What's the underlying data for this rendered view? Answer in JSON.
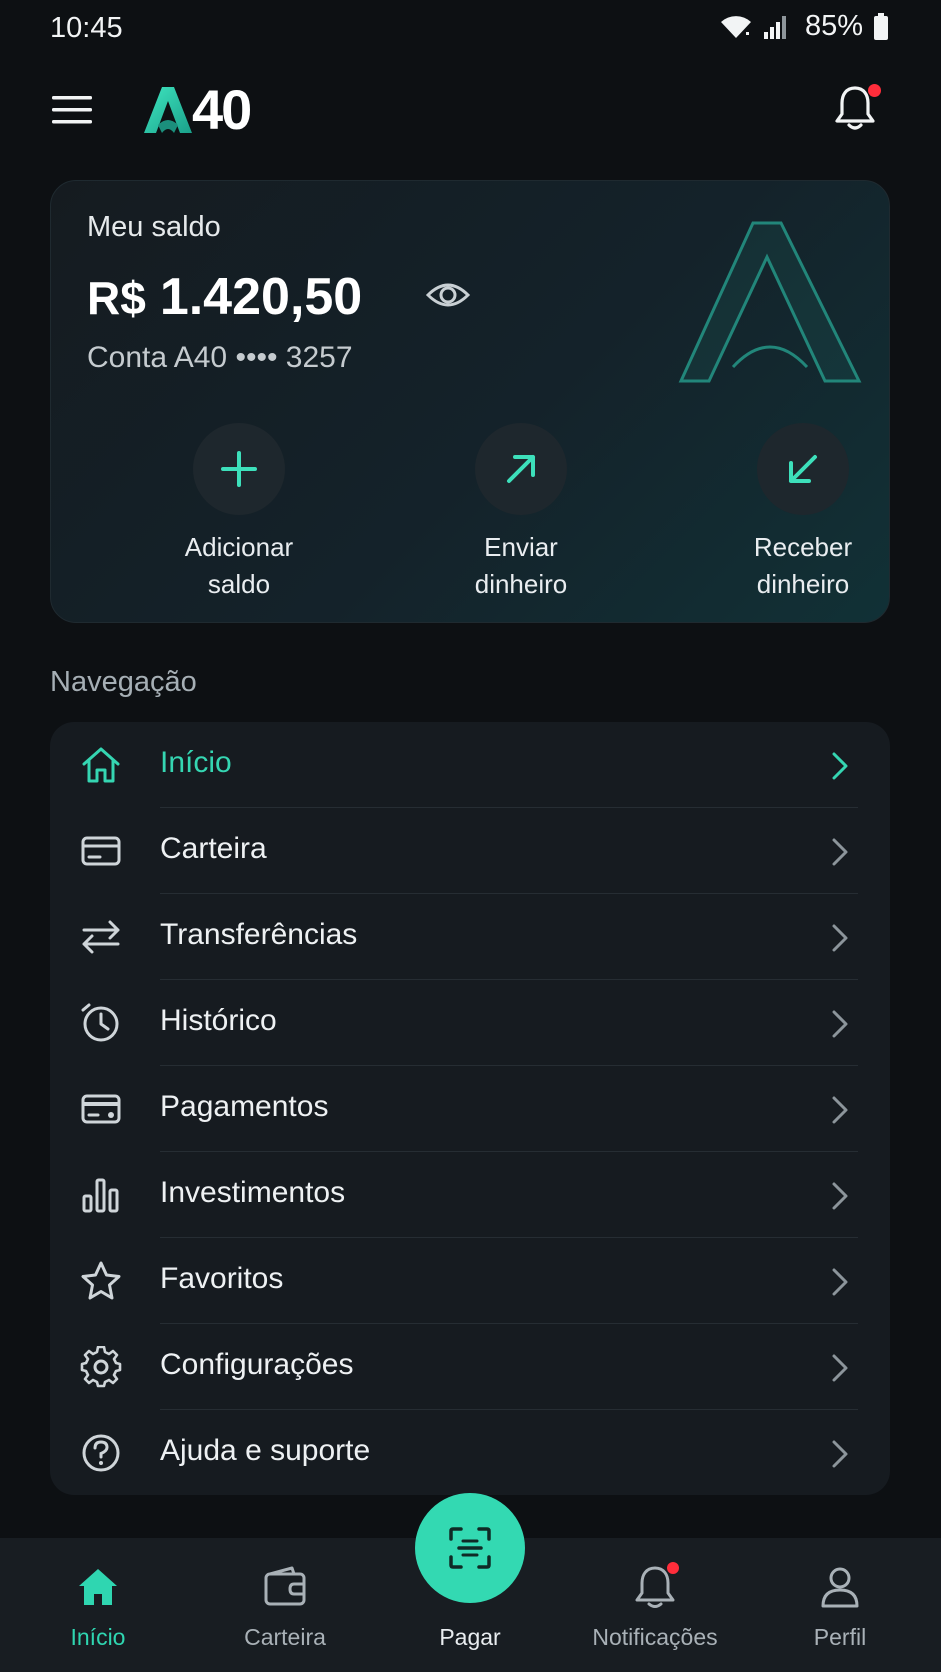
{
  "status_bar": {
    "time": "10:45",
    "battery": "85%"
  },
  "header": {
    "logo_text": "40"
  },
  "balance": {
    "label": "Meu saldo",
    "currency": "R$",
    "amount": "1.420,50",
    "account": "Conta A40 •••• 3257"
  },
  "actions": [
    {
      "label_line1": "Adicionar",
      "label_line2": "saldo",
      "icon": "plus-icon"
    },
    {
      "label_line1": "Enviar",
      "label_line2": "dinheiro",
      "icon": "arrow-up-right-icon"
    },
    {
      "label_line1": "Receber",
      "label_line2": "dinheiro",
      "icon": "arrow-down-left-icon"
    }
  ],
  "navigation": {
    "title": "Navegação",
    "items": [
      {
        "label": "Início",
        "icon": "home-icon",
        "active": true
      },
      {
        "label": "Carteira",
        "icon": "card-icon"
      },
      {
        "label": "Transferências",
        "icon": "transfer-icon"
      },
      {
        "label": "Histórico",
        "icon": "history-icon"
      },
      {
        "label": "Pagamentos",
        "icon": "payment-card-icon"
      },
      {
        "label": "Investimentos",
        "icon": "bar-chart-icon"
      },
      {
        "label": "Favoritos",
        "icon": "star-icon"
      },
      {
        "label": "Configurações",
        "icon": "gear-icon"
      },
      {
        "label": "Ajuda e suporte",
        "icon": "help-icon"
      }
    ]
  },
  "bottom_nav": {
    "items": [
      {
        "label": "Início",
        "icon": "home-icon",
        "active": true
      },
      {
        "label": "Carteira",
        "icon": "wallet-icon"
      },
      {
        "label": "Pagar",
        "icon": "scan-icon"
      },
      {
        "label": "Notificações",
        "icon": "bell-icon"
      },
      {
        "label": "Perfil",
        "icon": "user-icon"
      }
    ]
  },
  "colors": {
    "accent": "#33d9b2",
    "background": "#0d1013",
    "card": "#161b20",
    "badge": "#ff2d3b"
  }
}
